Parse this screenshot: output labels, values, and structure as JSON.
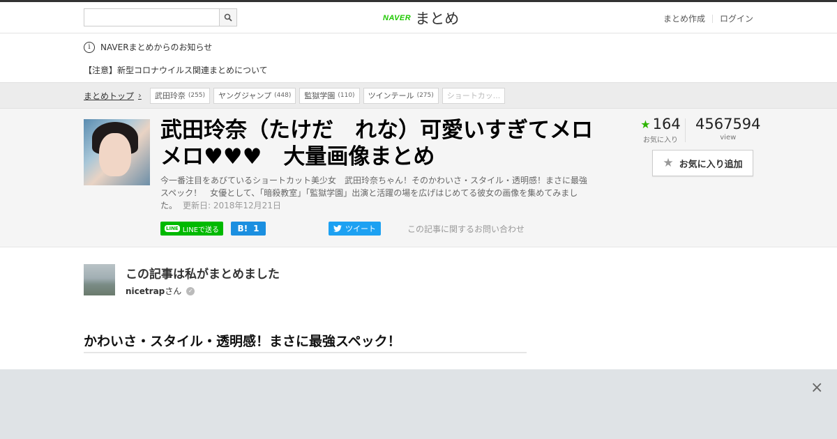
{
  "header": {
    "search_placeholder": "",
    "search_icon": "search-icon",
    "logo_naver": "NAVER",
    "logo_matome": "まとめ",
    "nav": [
      "まとめ作成",
      "ログイン"
    ]
  },
  "notice": {
    "icon": "info-icon",
    "title": "NAVERまとめからのお知らせ",
    "item": "【注意】新型コロナウイルス関連まとめについて"
  },
  "breadcrumb": {
    "top_label": "まとめトップ",
    "tags": [
      {
        "label": "武田玲奈",
        "count": "(255)"
      },
      {
        "label": "ヤングジャンプ",
        "count": "(448)"
      },
      {
        "label": "監獄学園",
        "count": "(110)"
      },
      {
        "label": "ツインテール",
        "count": "(275)"
      },
      {
        "label": "ショートカッ...",
        "count": ""
      }
    ]
  },
  "article": {
    "title": "武田玲奈（たけだ　れな）可愛いすぎてメロメロ♥♥♥　大量画像まとめ",
    "description": "今一番注目をあびているショートカット美少女　武田玲奈ちゃん！そのかわいさ・スタイル・透明感！まさに最強スペック！　女優として、「暗殺教室」「監獄学園」出演と活躍の場を広げはじめてる彼女の画像を集めてみました。",
    "updated": "更新日: 2018年12月21日",
    "share": {
      "line_label": "LINEで送る",
      "line_icon_text": "LINE",
      "hatena_label": "B!",
      "hatena_count": "1",
      "tweet_label": "ツイート",
      "contact_label": "この記事に関するお問い合わせ"
    },
    "stats": {
      "favorites": "164",
      "favorites_label": "お気に入り",
      "views": "4567594",
      "views_label": "view"
    },
    "fav_button_label": "お気に入り追加"
  },
  "author": {
    "heading": "この記事は私がまとめました",
    "username": "nicetrap",
    "suffix": "さん"
  },
  "section": {
    "heading": "かわいさ・スタイル・透明感！まさに最強スペック！"
  },
  "colors": {
    "naver_green": "#1ec800",
    "line_green": "#00b900",
    "hatena_blue": "#1b8fe0",
    "twitter_blue": "#1da1f2",
    "star_green": "#2db400"
  }
}
